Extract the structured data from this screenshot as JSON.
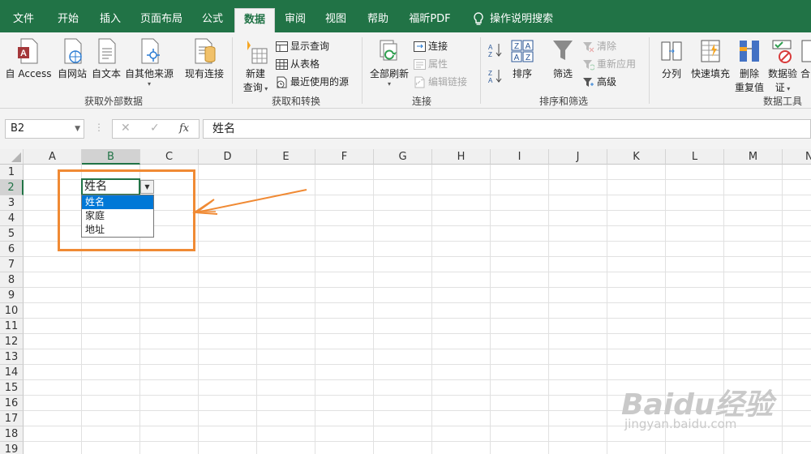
{
  "tabs": [
    {
      "label": "文件"
    },
    {
      "label": "开始"
    },
    {
      "label": "插入"
    },
    {
      "label": "页面布局"
    },
    {
      "label": "公式"
    },
    {
      "label": "数据",
      "active": true
    },
    {
      "label": "审阅"
    },
    {
      "label": "视图"
    },
    {
      "label": "帮助"
    },
    {
      "label": "福昕PDF"
    },
    {
      "label": "操作说明搜索"
    }
  ],
  "ribbon": {
    "get_external": {
      "access": "自 Access",
      "web": "自网站",
      "text": "自文本",
      "other": "自其他来源",
      "existing": "现有连接",
      "group": "获取外部数据"
    },
    "get_transform": {
      "new_query_1": "新建",
      "new_query_2": "查询",
      "show_queries": "显示查询",
      "from_table": "从表格",
      "recent": "最近使用的源",
      "group": "获取和转换"
    },
    "connections": {
      "refresh_all": "全部刷新",
      "conn": "连接",
      "props": "属性",
      "edit_links": "编辑链接",
      "group": "连接"
    },
    "sort_filter": {
      "sort": "排序",
      "filter": "筛选",
      "clear": "清除",
      "reapply": "重新应用",
      "advanced": "高级",
      "group": "排序和筛选"
    },
    "data_tools": {
      "split": "分列",
      "flash": "快速填充",
      "remove_1": "删除",
      "remove_2": "重复值",
      "validate_1": "数据验",
      "validate_2": "证",
      "combine": "合",
      "group": "数据工具"
    }
  },
  "formula_bar": {
    "name_box": "B2",
    "fx": "fx",
    "cancel": "✕",
    "enter": "✓",
    "content": "姓名"
  },
  "grid": {
    "columns": [
      "A",
      "B",
      "C",
      "D",
      "E",
      "F",
      "G",
      "H",
      "I",
      "J",
      "K",
      "L",
      "M",
      "N"
    ],
    "rows": [
      "1",
      "2",
      "3",
      "4",
      "5",
      "6",
      "7",
      "8",
      "9",
      "10",
      "11",
      "12",
      "13",
      "14",
      "15",
      "16",
      "17",
      "18",
      "19"
    ],
    "selected_col": "B",
    "selected_row": "2"
  },
  "cell": {
    "value": "姓名"
  },
  "dropdown": {
    "options": [
      "姓名",
      "家庭",
      "地址"
    ],
    "highlighted": "姓名"
  },
  "colors": {
    "brand": "#217346",
    "highlight": "#f08a34",
    "selection": "#0078d7"
  },
  "watermark": {
    "logo": "Baidu经验",
    "url": "jingyan.baidu.com"
  }
}
